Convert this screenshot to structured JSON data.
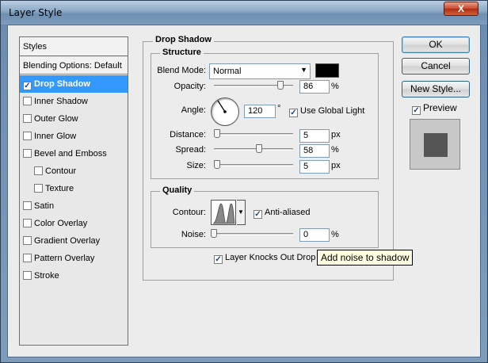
{
  "window": {
    "title": "Layer Style",
    "close_label": "X"
  },
  "styles_panel": {
    "header": "Styles",
    "blending_default": "Blending Options: Default",
    "items": [
      {
        "label": "Drop Shadow",
        "checked": true,
        "selected": true
      },
      {
        "label": "Inner Shadow",
        "checked": false
      },
      {
        "label": "Outer Glow",
        "checked": false
      },
      {
        "label": "Inner Glow",
        "checked": false
      },
      {
        "label": "Bevel and Emboss",
        "checked": false
      },
      {
        "label": "Contour",
        "checked": false,
        "sub": true
      },
      {
        "label": "Texture",
        "checked": false,
        "sub": true
      },
      {
        "label": "Satin",
        "checked": false
      },
      {
        "label": "Color Overlay",
        "checked": false
      },
      {
        "label": "Gradient Overlay",
        "checked": false
      },
      {
        "label": "Pattern Overlay",
        "checked": false
      },
      {
        "label": "Stroke",
        "checked": false
      }
    ]
  },
  "drop_shadow": {
    "group_title": "Drop Shadow",
    "structure": {
      "title": "Structure",
      "blend_mode_label": "Blend Mode:",
      "blend_mode_value": "Normal",
      "shadow_color": "#000000",
      "opacity_label": "Opacity:",
      "opacity_value": "86",
      "opacity_unit": "%",
      "angle_label": "Angle:",
      "angle_value": "120",
      "angle_unit": "°",
      "use_global_light_label": "Use Global Light",
      "use_global_light_checked": true,
      "distance_label": "Distance:",
      "distance_value": "5",
      "distance_unit": "px",
      "spread_label": "Spread:",
      "spread_value": "58",
      "spread_unit": "%",
      "size_label": "Size:",
      "size_value": "5",
      "size_unit": "px"
    },
    "quality": {
      "title": "Quality",
      "contour_label": "Contour:",
      "anti_aliased_label": "Anti-aliased",
      "anti_aliased_checked": true,
      "noise_label": "Noise:",
      "noise_value": "0",
      "noise_unit": "%"
    },
    "layer_knocks_out_label": "Layer Knocks Out Drop Sh",
    "layer_knocks_out_checked": true
  },
  "buttons": {
    "ok": "OK",
    "cancel": "Cancel",
    "new_style": "New Style...",
    "preview_label": "Preview",
    "preview_checked": true
  },
  "tooltip": "Add noise to shadow"
}
